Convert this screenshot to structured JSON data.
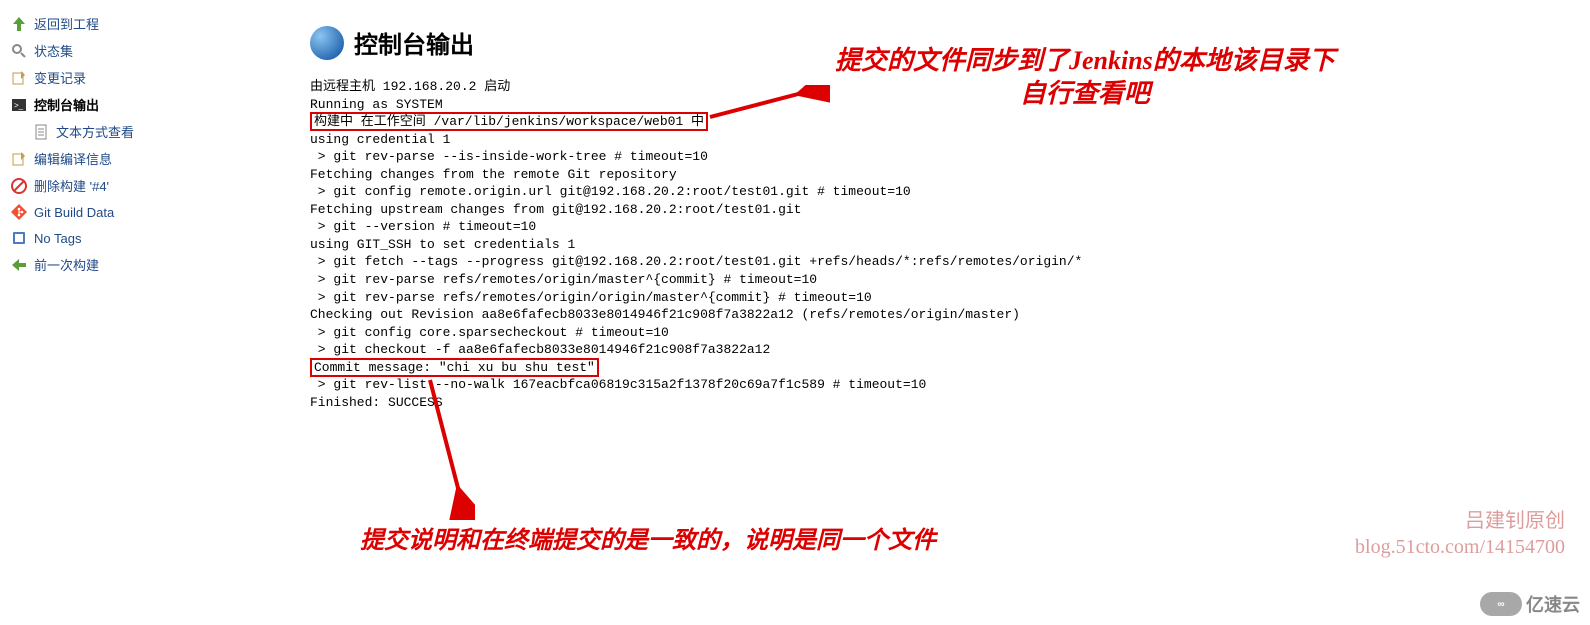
{
  "sidebar": {
    "items": [
      {
        "icon": "arrow-up-green",
        "label": "返回到工程"
      },
      {
        "icon": "magnify",
        "label": "状态集"
      },
      {
        "icon": "edit",
        "label": "变更记录"
      },
      {
        "icon": "terminal",
        "label": "控制台输出",
        "bold": true
      },
      {
        "icon": "page-text",
        "label": "文本方式查看",
        "sub": true
      },
      {
        "icon": "edit",
        "label": "编辑编译信息"
      },
      {
        "icon": "no-entry",
        "label": "删除构建 '#4'"
      },
      {
        "icon": "git",
        "label": "Git Build Data"
      },
      {
        "icon": "tag",
        "label": "No Tags"
      },
      {
        "icon": "arrow-left-green",
        "label": "前一次构建"
      }
    ]
  },
  "page": {
    "title": "控制台输出"
  },
  "console": {
    "l0": "由远程主机 192.168.20.2 启动",
    "l1": "Running as SYSTEM",
    "l2": "构建中 在工作空间 /var/lib/jenkins/workspace/web01 中",
    "l3": "using credential 1",
    "l4": " > git rev-parse --is-inside-work-tree # timeout=10",
    "l5": "Fetching changes from the remote Git repository",
    "l6": " > git config remote.origin.url git@192.168.20.2:root/test01.git # timeout=10",
    "l7": "Fetching upstream changes from git@192.168.20.2:root/test01.git",
    "l8": " > git --version # timeout=10",
    "l9": "using GIT_SSH to set credentials 1",
    "l10": " > git fetch --tags --progress git@192.168.20.2:root/test01.git +refs/heads/*:refs/remotes/origin/*",
    "l11": " > git rev-parse refs/remotes/origin/master^{commit} # timeout=10",
    "l12": " > git rev-parse refs/remotes/origin/origin/master^{commit} # timeout=10",
    "l13": "Checking out Revision aa8e6fafecb8033e8014946f21c908f7a3822a12 (refs/remotes/origin/master)",
    "l14": " > git config core.sparsecheckout # timeout=10",
    "l15": " > git checkout -f aa8e6fafecb8033e8014946f21c908f7a3822a12",
    "l16": "Commit message: \"chi xu bu shu test\"",
    "l17": " > git rev-list --no-walk 167eacbfca06819c315a2f1378f20c69a7f1c589 # timeout=10",
    "l18": "Finished: SUCCESS"
  },
  "annotations": {
    "a1_line1": "提交的文件同步到了Jenkins的本地该目录下",
    "a1_line2": "自行查看吧",
    "a2": "提交说明和在终端提交的是一致的，说明是同一个文件"
  },
  "watermark": {
    "line1": "吕建钊原创",
    "line2": "blog.51cto.com/14154700",
    "brand": "亿速云"
  }
}
